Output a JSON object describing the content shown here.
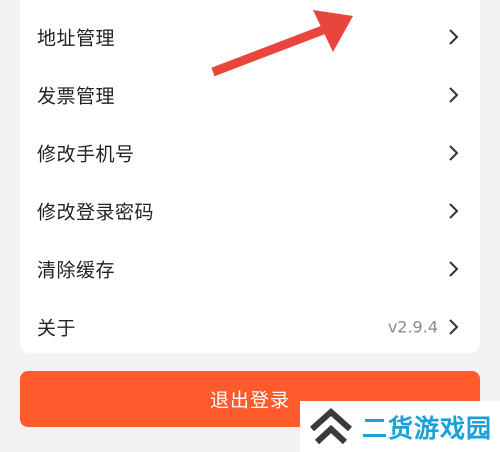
{
  "settings": {
    "items": [
      {
        "label": "地址管理",
        "value": ""
      },
      {
        "label": "发票管理",
        "value": ""
      },
      {
        "label": "修改手机号",
        "value": ""
      },
      {
        "label": "修改登录密码",
        "value": ""
      },
      {
        "label": "清除缓存",
        "value": ""
      },
      {
        "label": "关于",
        "value": "v2.9.4"
      }
    ],
    "logout_label": "退出登录"
  },
  "watermark": {
    "text": "二货游戏园"
  },
  "colors": {
    "accent": "#ff5a2c",
    "annotation_arrow": "#e8453c",
    "watermark_blue": "#1aa0d8",
    "watermark_dark": "#3a3a3a"
  }
}
